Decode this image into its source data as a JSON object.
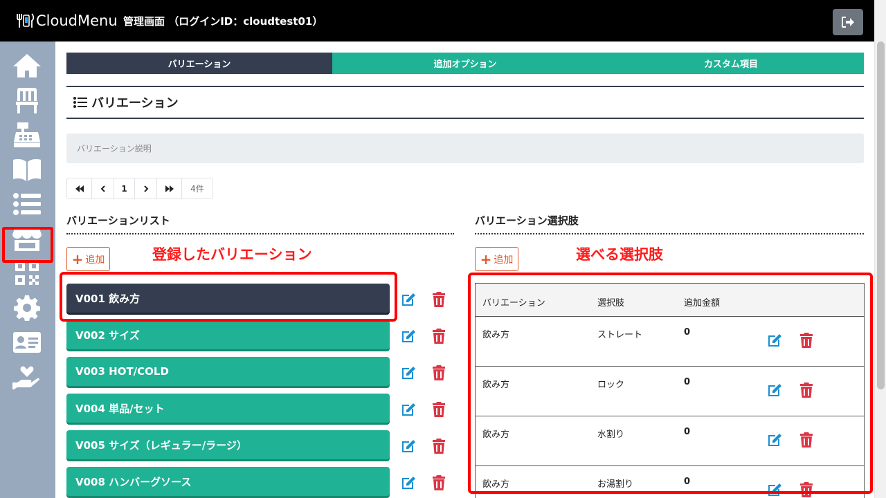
{
  "header": {
    "logo_text": "CloudMenu",
    "admin_title": "管理画面 （ログインID：cloudtest01）"
  },
  "sidebar": {
    "items": [
      {
        "icon": "home-icon"
      },
      {
        "icon": "chair-icon"
      },
      {
        "icon": "cash-register-icon"
      },
      {
        "icon": "book-icon"
      },
      {
        "icon": "list-icon",
        "active": true
      },
      {
        "icon": "store-icon"
      },
      {
        "icon": "qr-code-icon"
      },
      {
        "icon": "gear-icon"
      },
      {
        "icon": "id-card-icon"
      },
      {
        "icon": "hand-heart-icon"
      }
    ]
  },
  "tabs": [
    {
      "label": "バリエーション",
      "active": true
    },
    {
      "label": "追加オプション"
    },
    {
      "label": "カスタム項目"
    }
  ],
  "section": {
    "title": "バリエーション",
    "description_placeholder": "バリエーション説明"
  },
  "pagination": {
    "first": "◀◀",
    "prev": "‹",
    "page": "1",
    "next": "›",
    "last": "▶▶",
    "count": "4件"
  },
  "left": {
    "heading": "バリエーションリスト",
    "add_label": "追加",
    "annotation": "登録したバリエーション",
    "items": [
      {
        "label": "V001 飲み方",
        "active": true
      },
      {
        "label": "V002 サイズ"
      },
      {
        "label": "V003 HOT/COLD"
      },
      {
        "label": "V004 単品/セット"
      },
      {
        "label": "V005 サイズ（レギュラー/ラージ）"
      },
      {
        "label": "V008 ハンバーグソース"
      }
    ]
  },
  "right": {
    "heading": "バリエーション選択肢",
    "add_label": "追加",
    "annotation": "選べる選択肢",
    "columns": [
      "バリエーション",
      "選択肢",
      "追加金額"
    ],
    "rows": [
      {
        "variation": "飲み方",
        "option": "ストレート",
        "price": "0"
      },
      {
        "variation": "飲み方",
        "option": "ロック",
        "price": "0"
      },
      {
        "variation": "飲み方",
        "option": "水割り",
        "price": "0"
      },
      {
        "variation": "飲み方",
        "option": "お湯割り",
        "price": "0"
      }
    ]
  },
  "colors": {
    "header_bg": "#000000",
    "sidebar_bg": "#98a9bd",
    "tab_active": "#343e50",
    "tab_inactive": "#20b295",
    "edit_icon": "#1a8fd1",
    "delete_icon": "#dc3545",
    "highlight": "#ff0000",
    "annotation_text": "#ff1c1c"
  }
}
